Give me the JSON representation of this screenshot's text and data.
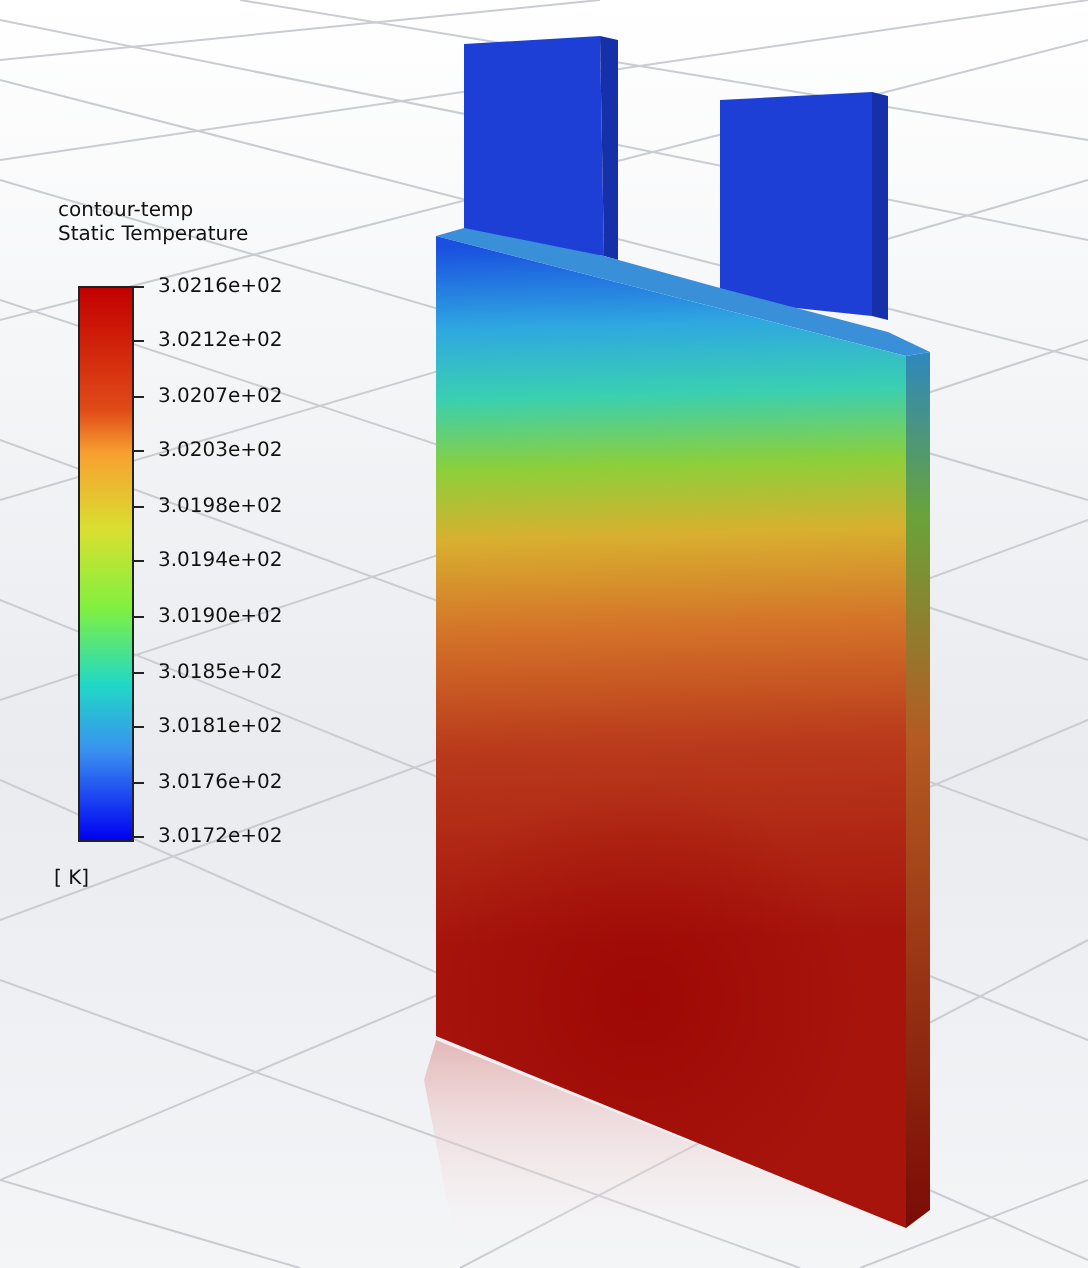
{
  "legend": {
    "title": "contour-temp",
    "subtitle": "Static Temperature",
    "labels": [
      "3.0216e+02",
      "3.0212e+02",
      "3.0207e+02",
      "3.0203e+02",
      "3.0198e+02",
      "3.0194e+02",
      "3.0190e+02",
      "3.0185e+02",
      "3.0181e+02",
      "3.0176e+02",
      "3.0172e+02"
    ],
    "unit": "[ K]"
  }
}
